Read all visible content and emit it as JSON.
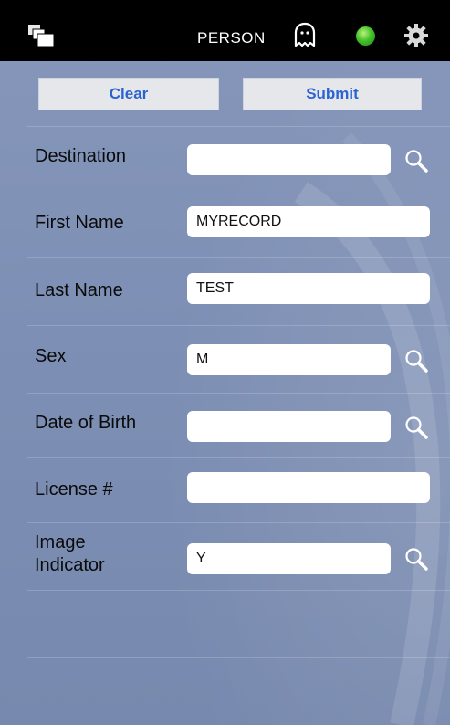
{
  "header": {
    "title": "PERSON",
    "icons": [
      "windows-icon",
      "ghost-icon",
      "status-dot-icon",
      "gear-icon"
    ],
    "status_color": "#3fbf2a"
  },
  "actions": {
    "clear_label": "Clear",
    "submit_label": "Submit",
    "accent_color": "#2b64d2"
  },
  "form": {
    "destination": {
      "label": "Destination",
      "value": "",
      "lookup_icon": "search-icon"
    },
    "first_name": {
      "label": "First Name",
      "value": "MYRECORD"
    },
    "last_name": {
      "label": "Last Name",
      "value": "TEST"
    },
    "sex": {
      "label": "Sex",
      "value": "M",
      "lookup_icon": "search-icon"
    },
    "dob": {
      "label": "Date of Birth",
      "value": "",
      "lookup_icon": "search-icon"
    },
    "license": {
      "label": "License #",
      "value": ""
    },
    "image_indicator": {
      "label_line1": "Image",
      "label_line2": "Indicator",
      "value": "Y",
      "lookup_icon": "search-icon"
    }
  }
}
